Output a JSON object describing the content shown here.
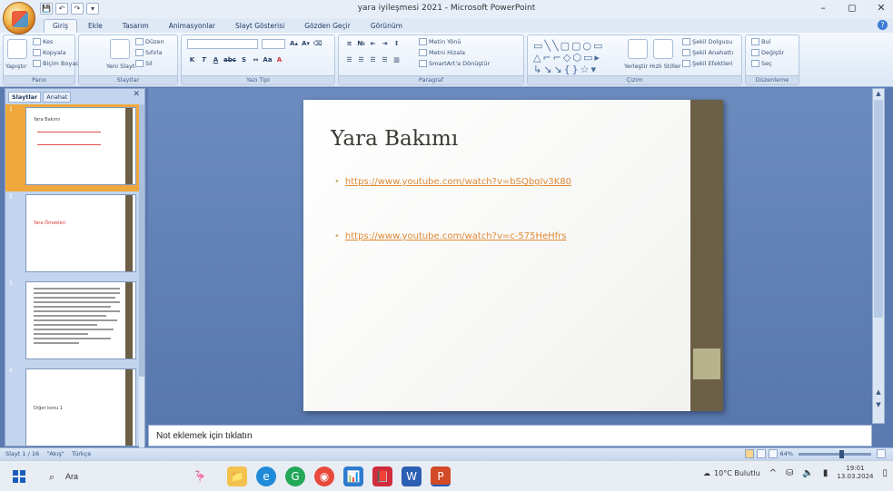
{
  "window": {
    "title": "yara iyileşmesi 2021 - Microsoft PowerPoint",
    "qat": [
      "💾",
      "↶",
      "↷",
      "▾"
    ],
    "controls": [
      "–",
      "◻",
      "✕"
    ]
  },
  "ribbon": {
    "tabs": [
      "Giriş",
      "Ekle",
      "Tasarım",
      "Animasyonlar",
      "Slayt Gösterisi",
      "Gözden Geçir",
      "Görünüm"
    ],
    "active_tab": "Giriş",
    "groups": {
      "clipboard": {
        "label": "Pano",
        "paste": "Yapıştır",
        "cut": "Kes",
        "copy": "Kopyala",
        "format_painter": "Biçim Boyacısı"
      },
      "slides": {
        "label": "Slaytlar",
        "new_slide": "Yeni Slayt",
        "layout": "Düzen",
        "reset": "Sıfırla",
        "delete": "Sil"
      },
      "font": {
        "label": "Yazı Tipi",
        "bold": "K",
        "italic": "T",
        "underline": "A",
        "strike": "abc",
        "shadow": "S"
      },
      "paragraph": {
        "label": "Paragraf",
        "text_direction": "Metin Yönü",
        "align_text": "Metni Hizala",
        "smartart": "SmartArt'a Dönüştür"
      },
      "drawing": {
        "label": "Çizim",
        "arrange": "Yerleştir",
        "quick_styles": "Hızlı Stiller",
        "shape_fill": "Şekil Dolgusu",
        "shape_outline": "Şekil Anahattı",
        "shape_effects": "Şekil Efektleri"
      },
      "editing": {
        "label": "Düzenleme",
        "find": "Bul",
        "replace": "Değiştir",
        "select": "Seç"
      }
    }
  },
  "left_pane": {
    "tabs": [
      "Slaytlar",
      "Anahat"
    ],
    "active_tab": "Slaytlar",
    "close": "✕",
    "slides": [
      {
        "number": "1",
        "title": "Yara Bakımı"
      },
      {
        "number": "2",
        "title": "Yara Örnekleri"
      },
      {
        "number": "3",
        "title": ""
      },
      {
        "number": "4",
        "title": "Diğer konu 1"
      }
    ]
  },
  "slide": {
    "title": "Yara Bakımı",
    "bullets": [
      "https://www.youtube.com/watch?v=bSQbgIv3K80",
      "https://www.youtube.com/watch?v=c-575HeHfrs"
    ]
  },
  "notes": {
    "placeholder": "Not eklemek için tıklatın"
  },
  "status": {
    "slide_info": "Slayt 1 / 16",
    "theme": "\"Akış\"",
    "language": "Türkçe",
    "zoom": "64%"
  },
  "taskbar": {
    "search": "Ara",
    "apps": [
      "🦩",
      "📁",
      "e",
      "G",
      "◉",
      "📊",
      "📕",
      "W",
      "P"
    ],
    "weather": "10°C Bulutlu",
    "time": "19:01",
    "date": "13.03.2024"
  }
}
